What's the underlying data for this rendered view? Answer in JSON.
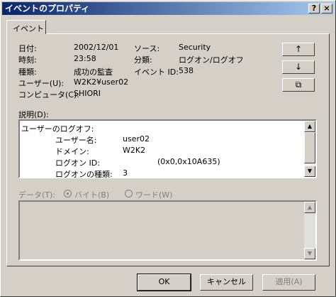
{
  "window": {
    "title": "イベントのプロパティ",
    "help_btn": "?",
    "close_btn": "×"
  },
  "tabs": [
    {
      "label": "イベント"
    }
  ],
  "fields": {
    "date_label": "日付:",
    "date_value": "2002/12/01",
    "source_label": "ソース:",
    "source_value": "Security",
    "time_label": "時刻:",
    "time_value": "23:58",
    "category_label": "分類:",
    "category_value": "ログオン/ログオフ",
    "type_label": "種類:",
    "type_value": "成功の監査",
    "event_id_label": "イベント ID:",
    "event_id_value": "538",
    "user_label": "ユーザー(U):",
    "user_value": "W2K2¥user02",
    "computer_label": "コンピュータ(C):",
    "computer_value": "SHIORI"
  },
  "nav_buttons": {
    "up": "↑",
    "down": "↓",
    "copy": "⧉"
  },
  "description": {
    "label": "説明(D):",
    "lines": [
      {
        "key": "ユーザーのログオフ:",
        "value": ""
      },
      {
        "key": "ユーザー名:",
        "value": "user02"
      },
      {
        "key": "ドメイン:",
        "value": "W2K2"
      },
      {
        "key": "ログオン ID:",
        "value": "(0x0,0x10A635)"
      },
      {
        "key": "ログオンの種類:",
        "value": "3"
      }
    ]
  },
  "data_section": {
    "label": "データ(T):",
    "byte_option": "バイト(B)",
    "word_option": "ワード(W)",
    "selected": "byte"
  },
  "buttons": {
    "ok": "OK",
    "cancel": "キャンセル",
    "apply": "適用(A)"
  }
}
